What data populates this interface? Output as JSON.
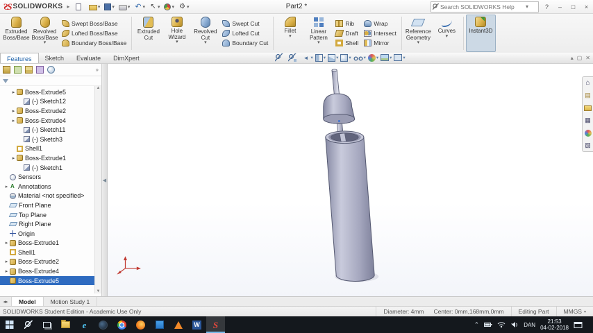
{
  "colors": {
    "selection_blue": "#2e6bc0",
    "ribbon_active_bg": "#ccd9e5",
    "taskbar_bg": "#14181d",
    "brand_red": "#d02828",
    "feature_gold": "#d9ae45"
  },
  "titlebar": {
    "app_name": "SOLIDWORKS",
    "document_title": "Part2 *",
    "search_placeholder": "Search SOLIDWORKS Help",
    "quick_icons": [
      {
        "name": "new-document",
        "arrow": false
      },
      {
        "name": "open",
        "arrow": true
      },
      {
        "name": "save",
        "arrow": true
      },
      {
        "name": "print",
        "arrow": true
      },
      {
        "name": "undo",
        "arrow": true
      },
      {
        "name": "select",
        "arrow": true
      },
      {
        "name": "rebuild",
        "arrow": true
      },
      {
        "name": "options",
        "arrow": true
      }
    ],
    "help_label": "?",
    "search_caret": "▾",
    "minimize_label": "–",
    "maximize_label": "□",
    "close_label": "×"
  },
  "ribbon_tabs": [
    {
      "label": "Features",
      "active": true
    },
    {
      "label": "Sketch",
      "active": false
    },
    {
      "label": "Evaluate",
      "active": false
    },
    {
      "label": "DimXpert",
      "active": false
    }
  ],
  "ribbon": {
    "large_group1": [
      {
        "label": "Extruded Boss/Base",
        "icon": "extruded-boss",
        "arrow": false,
        "active": false
      },
      {
        "label": "Revolved Boss/Base",
        "icon": "revolved-boss",
        "arrow": true,
        "active": false
      }
    ],
    "small_group1": [
      {
        "label": "Swept Boss/Base",
        "icon": "swept-boss"
      },
      {
        "label": "Lofted Boss/Base",
        "icon": "lofted-boss"
      },
      {
        "label": "Boundary Boss/Base",
        "icon": "boundary-boss"
      }
    ],
    "large_group2": [
      {
        "label": "Extruded Cut",
        "icon": "extruded-cut",
        "arrow": false,
        "active": false
      },
      {
        "label": "Hole Wizard",
        "icon": "hole-wizard",
        "arrow": true,
        "active": false
      },
      {
        "label": "Revolved Cut",
        "icon": "revolved-cut",
        "arrow": true,
        "active": false
      }
    ],
    "small_group2": [
      {
        "label": "Swept Cut",
        "icon": "swept-cut"
      },
      {
        "label": "Lofted Cut",
        "icon": "lofted-cut"
      },
      {
        "label": "Boundary Cut",
        "icon": "boundary-cut"
      }
    ],
    "large_group3": [
      {
        "label": "Fillet",
        "icon": "fillet",
        "arrow": true,
        "active": false
      },
      {
        "label": "Linear Pattern",
        "icon": "linear-pattern",
        "arrow": true,
        "active": false
      }
    ],
    "small_group3": [
      {
        "label": "Rib",
        "icon": "rib"
      },
      {
        "label": "Draft",
        "icon": "draft"
      },
      {
        "label": "Shell",
        "icon": "shell"
      }
    ],
    "small_group4": [
      {
        "label": "Wrap",
        "icon": "wrap"
      },
      {
        "label": "Intersect",
        "icon": "intersect"
      },
      {
        "label": "Mirror",
        "icon": "mirror"
      }
    ],
    "large_group4": [
      {
        "label": "Reference Geometry",
        "icon": "reference-geometry",
        "arrow": true,
        "active": false
      },
      {
        "label": "Curves",
        "icon": "curves",
        "arrow": true,
        "active": false
      }
    ],
    "large_group5": [
      {
        "label": "Instant3D",
        "icon": "instant3d",
        "arrow": false,
        "active": true
      }
    ]
  },
  "feature_manager": {
    "tabs": [
      {
        "name": "featuremanager"
      },
      {
        "name": "propertymanager"
      },
      {
        "name": "configurationmanager"
      },
      {
        "name": "dimxpertmanager"
      },
      {
        "name": "displaymanager"
      }
    ],
    "chevron": "»",
    "scroll_up": "▲",
    "scroll_down": "▼"
  },
  "feature_tree": {
    "items": [
      {
        "label": "Boss-Extrude5",
        "icon": "boss-extrude",
        "indent": 1,
        "expand": true,
        "selected": false
      },
      {
        "label": "(-) Sketch12",
        "icon": "sketch",
        "indent": 2,
        "expand": false,
        "selected": false
      },
      {
        "label": "Boss-Extrude2",
        "icon": "boss-extrude",
        "indent": 1,
        "expand": true,
        "selected": false
      },
      {
        "label": "Boss-Extrude4",
        "icon": "boss-extrude",
        "indent": 1,
        "expand": true,
        "selected": false
      },
      {
        "label": "(-) Sketch11",
        "icon": "sketch",
        "indent": 2,
        "expand": false,
        "selected": false
      },
      {
        "label": "(-) Sketch3",
        "icon": "sketch",
        "indent": 2,
        "expand": false,
        "selected": false
      },
      {
        "label": "Shell1",
        "icon": "shell-feature",
        "indent": 1,
        "expand": false,
        "selected": false
      },
      {
        "label": "Boss-Extrude1",
        "icon": "boss-extrude",
        "indent": 1,
        "expand": true,
        "selected": false
      },
      {
        "label": "(-) Sketch1",
        "icon": "sketch",
        "indent": 2,
        "expand": false,
        "selected": false
      },
      {
        "label": "Sensors",
        "icon": "sensors",
        "indent": 0,
        "expand": false,
        "selected": false
      },
      {
        "label": "Annotations",
        "icon": "annotations",
        "indent": 0,
        "expand": true,
        "selected": false
      },
      {
        "label": "Material <not specified>",
        "icon": "material",
        "indent": 0,
        "expand": false,
        "selected": false
      },
      {
        "label": "Front Plane",
        "icon": "plane",
        "indent": 0,
        "expand": false,
        "selected": false
      },
      {
        "label": "Top Plane",
        "icon": "plane",
        "indent": 0,
        "expand": false,
        "selected": false
      },
      {
        "label": "Right Plane",
        "icon": "plane",
        "indent": 0,
        "expand": false,
        "selected": false
      },
      {
        "label": "Origin",
        "icon": "origin",
        "indent": 0,
        "expand": false,
        "selected": false
      },
      {
        "label": "Boss-Extrude1",
        "icon": "boss-extrude",
        "indent": 0,
        "expand": true,
        "selected": false
      },
      {
        "label": "Shell1",
        "icon": "shell-feature",
        "indent": 0,
        "expand": false,
        "selected": false
      },
      {
        "label": "Boss-Extrude2",
        "icon": "boss-extrude",
        "indent": 0,
        "expand": true,
        "selected": false
      },
      {
        "label": "Boss-Extrude4",
        "icon": "boss-extrude",
        "indent": 0,
        "expand": true,
        "selected": false
      },
      {
        "label": "Boss-Extrude5",
        "icon": "boss-extrude",
        "indent": 0,
        "expand": false,
        "selected": true
      }
    ]
  },
  "viewport_toolbar": [
    {
      "name": "zoom-fit",
      "arrow": false
    },
    {
      "name": "zoom-area",
      "arrow": false
    },
    {
      "name": "previous-view",
      "arrow": true
    },
    {
      "name": "section-view",
      "arrow": true
    },
    {
      "name": "view-orientation",
      "arrow": true
    },
    {
      "name": "display-style",
      "arrow": true
    },
    {
      "name": "hide-show-items",
      "arrow": true
    },
    {
      "name": "edit-appearance",
      "arrow": true
    },
    {
      "name": "apply-scene",
      "arrow": true
    },
    {
      "name": "view-settings",
      "arrow": true
    }
  ],
  "task_pane": {
    "icons": [
      "solidworks-resources",
      "design-library",
      "file-explorer-pane",
      "view-palette",
      "appearances-scenes",
      "custom-properties"
    ]
  },
  "bottom_tabs": [
    {
      "label": "Model",
      "active": true
    },
    {
      "label": "Motion Study 1",
      "active": false
    }
  ],
  "statusbar": {
    "left_text": "SOLIDWORKS Student Edition - Academic Use Only",
    "diameter": "Diameter: 4mm",
    "center": "Center: 0mm,168mm,0mm",
    "mode": "Editing Part",
    "units": "MMGS"
  },
  "taskbar": {
    "apps": [
      {
        "name": "start",
        "active": false
      },
      {
        "name": "search-taskbar",
        "active": false
      },
      {
        "name": "task-view",
        "active": false
      },
      {
        "name": "file-explorer",
        "active": false
      },
      {
        "name": "edge",
        "active": false
      },
      {
        "name": "steam",
        "active": false
      },
      {
        "name": "chrome",
        "active": false
      },
      {
        "name": "firefox",
        "active": false
      },
      {
        "name": "photos",
        "active": false
      },
      {
        "name": "vlc",
        "active": false
      },
      {
        "name": "word",
        "active": false
      },
      {
        "name": "solidworks",
        "active": true
      }
    ],
    "language": "DAN",
    "time": "21:53",
    "date": "04-02-2018"
  }
}
